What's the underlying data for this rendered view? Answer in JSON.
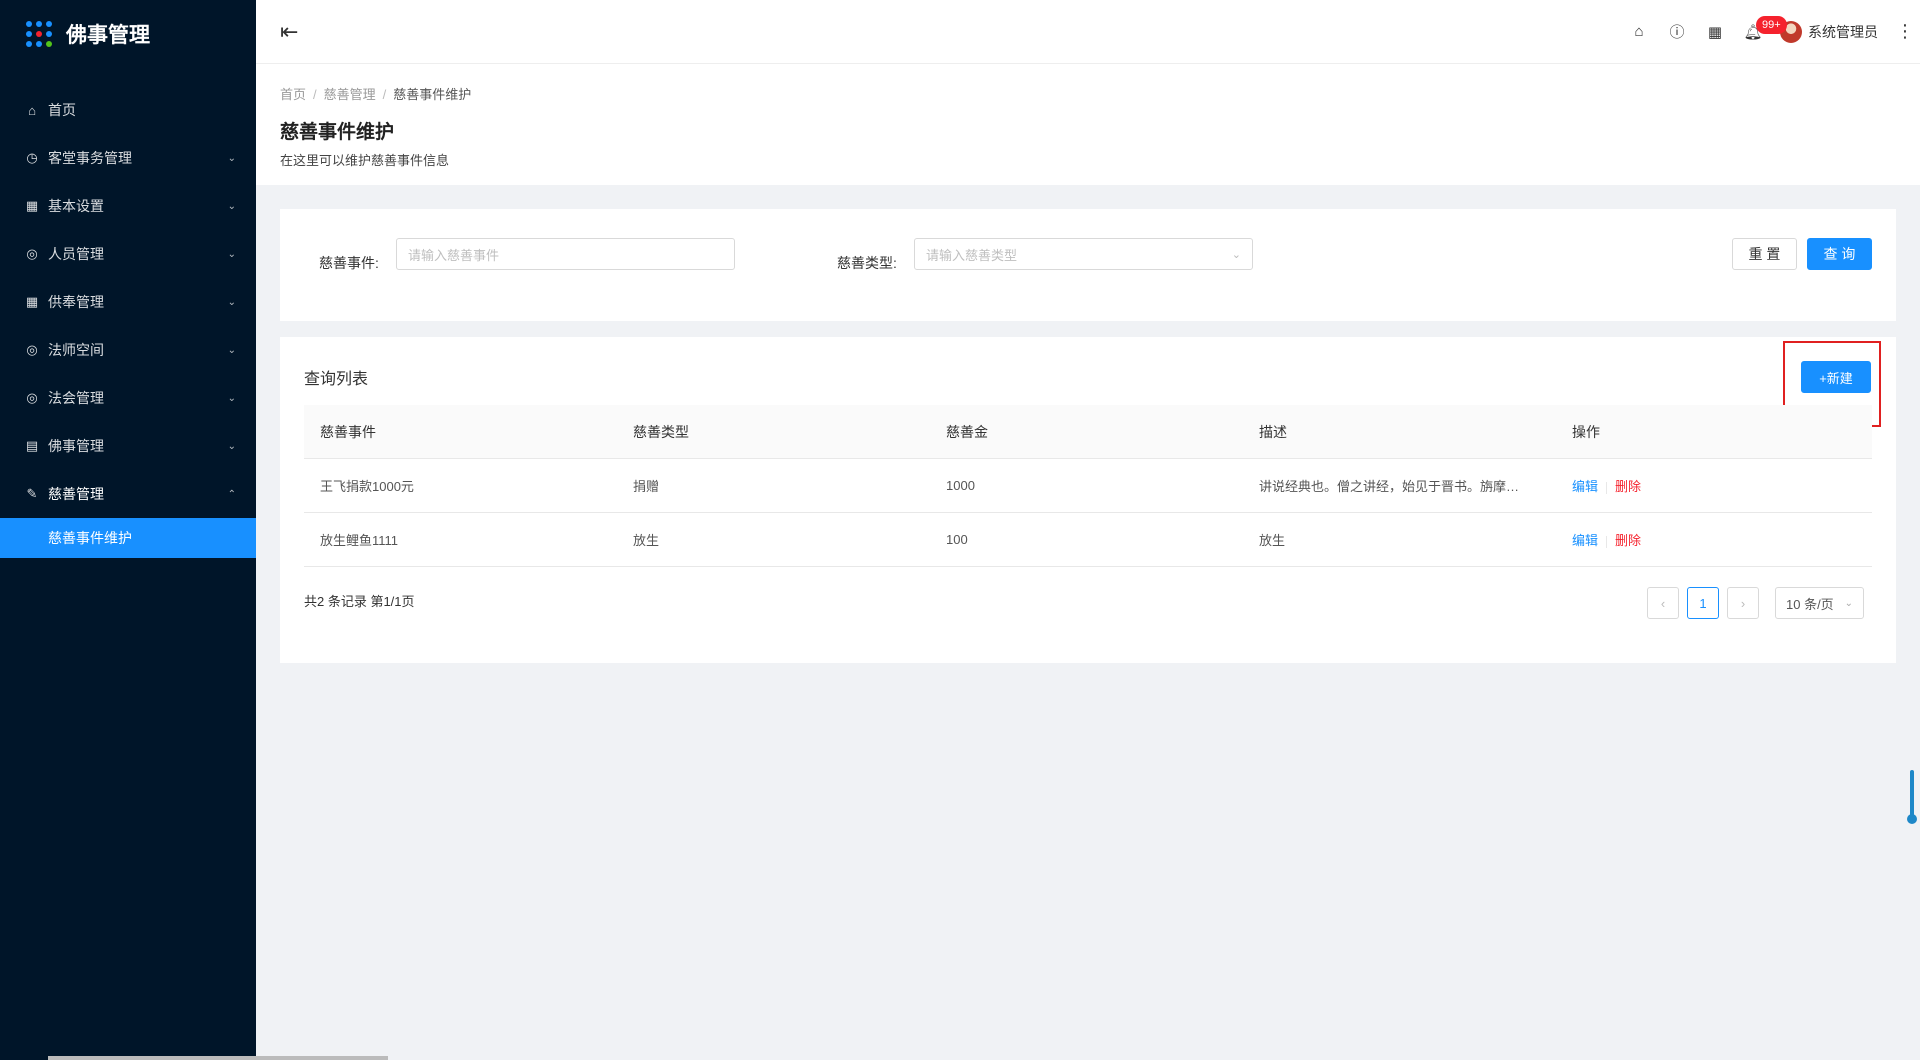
{
  "app": {
    "title": "佛事管理"
  },
  "colors": {
    "sidebar_bg": "#001529",
    "primary": "#1890ff",
    "danger": "#f5222d",
    "highlight": "#e02020",
    "logo_dots": [
      "#1890ff",
      "#1890ff",
      "#1890ff",
      "#1890ff",
      "#f5222d",
      "#1890ff",
      "#1890ff",
      "#1890ff",
      "#52c41a"
    ]
  },
  "sidebar": {
    "items": [
      {
        "label": "首页",
        "icon": "home-icon"
      },
      {
        "label": "客堂事务管理",
        "icon": "dashboard-icon"
      },
      {
        "label": "基本设置",
        "icon": "table-icon"
      },
      {
        "label": "人员管理",
        "icon": "check-circle-icon"
      },
      {
        "label": "供奉管理",
        "icon": "table-icon"
      },
      {
        "label": "法师空间",
        "icon": "check-circle-icon"
      },
      {
        "label": "法会管理",
        "icon": "check-circle-icon"
      },
      {
        "label": "佛事管理",
        "icon": "profile-icon"
      },
      {
        "label": "慈善管理",
        "icon": "form-icon"
      }
    ],
    "active_sub": "慈善事件维护"
  },
  "header": {
    "badge": "99+",
    "user_name": "系统管理员"
  },
  "breadcrumb": {
    "items": [
      "首页",
      "慈善管理",
      "慈善事件维护"
    ]
  },
  "page": {
    "title": "慈善事件维护",
    "desc": "在这里可以维护慈善事件信息"
  },
  "search": {
    "event_label": "慈善事件:",
    "event_placeholder": "请输入慈善事件",
    "type_label": "慈善类型:",
    "type_placeholder": "请输入慈善类型",
    "reset_label": "重 置",
    "query_label": "查 询"
  },
  "list": {
    "title": "查询列表",
    "new_label": "+新建",
    "columns": [
      "慈善事件",
      "慈善类型",
      "慈善金",
      "描述",
      "操作"
    ],
    "rows": [
      {
        "event": "王飞捐款1000元",
        "type": "捐赠",
        "amount": "1000",
        "desc": "讲说经典也。僧之讲经，始见于晋书。旃摩…",
        "edit": "编辑",
        "del": "删除"
      },
      {
        "event": "放生鲤鱼1111",
        "type": "放生",
        "amount": "100",
        "desc": "放生",
        "edit": "编辑",
        "del": "删除"
      }
    ],
    "total": "共2 条记录 第1/1页",
    "current_page": "1",
    "page_size": "10 条/页"
  }
}
